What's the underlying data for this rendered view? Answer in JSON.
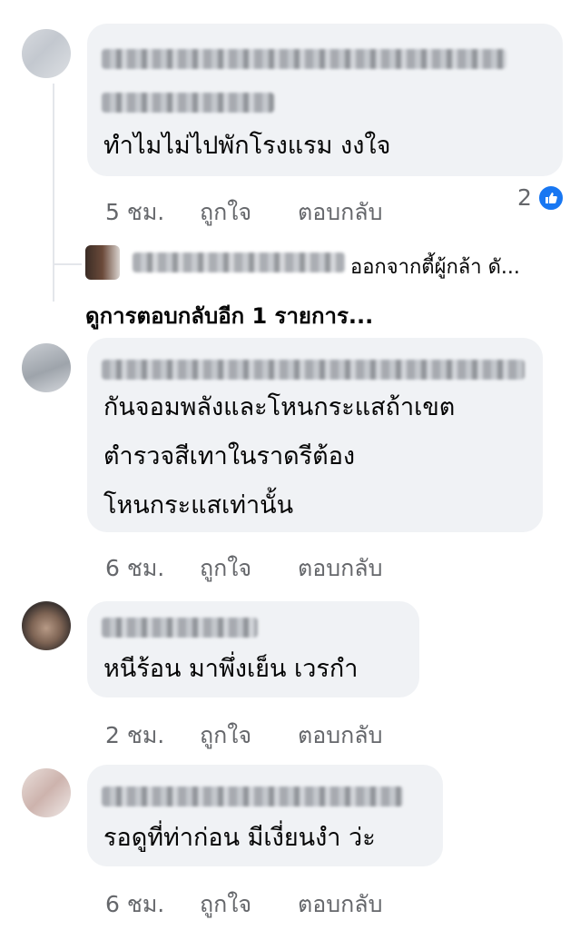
{
  "comments": [
    {
      "text_lines": [
        "ทำไมไม่ไปพักโรงแรม งงใจ"
      ],
      "time": "5 ชม.",
      "like_label": "ถูกใจ",
      "reply_label": "ตอบกลับ",
      "reaction_count": "2"
    },
    {
      "text_lines": [
        "กันจอมพลังและโหนกระแสถ้าเขต",
        "ตำรวจสีเทาในราดรีต้อง",
        "โหนกระแสเท่านั้น"
      ],
      "time": "6 ชม.",
      "like_label": "ถูกใจ",
      "reply_label": "ตอบกลับ"
    },
    {
      "text_lines": [
        "หนีร้อน มาพึ่งเย็น เวรกำ"
      ],
      "time": "2 ชม.",
      "like_label": "ถูกใจ",
      "reply_label": "ตอบกลับ"
    },
    {
      "text_lines": [
        "รอดูที่ท่าก่อน มีเงี่ยนงำ ว่ะ"
      ],
      "time": "6 ชม.",
      "like_label": "ถูกใจ",
      "reply_label": "ตอบกลับ"
    }
  ],
  "reply_preview": {
    "text": "ออกจากตี้ผู้กล้า ดั..."
  },
  "more_replies": {
    "label": "ดูการตอบกลับอีก 1 รายการ..."
  },
  "icons": {
    "like_badge": "thumbs-up-icon"
  },
  "colors": {
    "bubble": "#f0f2f5",
    "meta": "#65676b",
    "like_blue": "#1877f2"
  }
}
